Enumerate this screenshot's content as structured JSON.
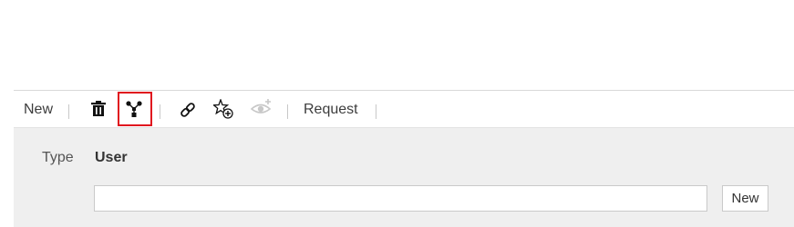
{
  "toolbar": {
    "new_label": "New",
    "request_label": "Request",
    "icons": [
      "trash-icon",
      "hierarchy-icon",
      "link-icon",
      "star-add-icon",
      "watch-add-icon"
    ]
  },
  "form": {
    "type_label": "Type",
    "type_value": "User",
    "input_value": "",
    "new_button_label": "New"
  },
  "colors": {
    "highlight": "#e0141e",
    "panel_bg": "#efefef",
    "disabled_icon": "#c8c8c8"
  }
}
